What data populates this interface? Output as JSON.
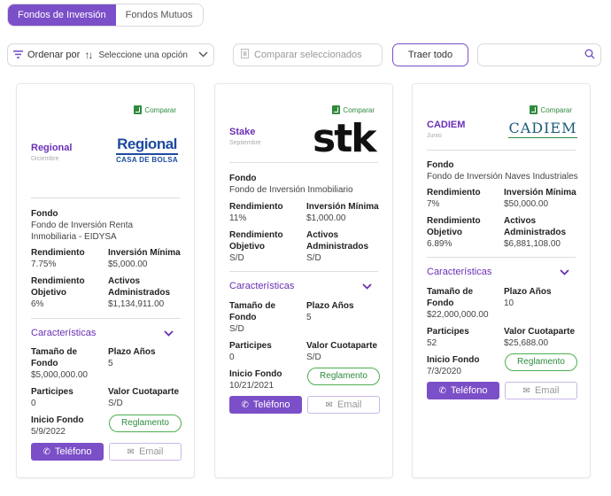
{
  "tabs": [
    {
      "label": "Fondos de Inversión",
      "active": true
    },
    {
      "label": "Fondos Mutuos",
      "active": false
    }
  ],
  "toolbar": {
    "sort_label": "Ordenar por",
    "select_placeholder": "Seleccione una opción",
    "compare_label": "Comparar seleccionados",
    "traer_label": "Traer todo",
    "search_value": ""
  },
  "colors": {
    "accent": "#7b4fc8",
    "compare_green": "#2e8b3e"
  },
  "cards": [
    {
      "name": "Regional",
      "subtitle": "Diciembre",
      "compare": "Comparar",
      "logo": {
        "line1": "Regional",
        "line2": "CASA DE BOLSA"
      },
      "fondo_label": "Fondo",
      "fondo_value": "Fondo de Inversión Renta Inmobiliaria - EIDYSA",
      "rendimiento_label": "Rendimiento",
      "rendimiento_value": "7.75%",
      "inversion_label": "Inversión Mínima",
      "inversion_value": "$5,000.00",
      "rend_obj_label": "Rendimiento Objetivo",
      "rend_obj_value": "6%",
      "activos_label": "Activos Administrados",
      "activos_value": "$1,134,911.00",
      "caracteristicas": "Características",
      "tamano_label": "Tamaño de Fondo",
      "tamano_value": "$5,000,000.00",
      "plazo_label": "Plazo Años",
      "plazo_value": "5",
      "participes_label": "Participes",
      "participes_value": "0",
      "cuotaparte_label": "Valor Cuotaparte",
      "cuotaparte_value": "S/D",
      "inicio_label": "Inicio Fondo",
      "inicio_value": "5/9/2022",
      "reglamento": "Reglamento",
      "telefono": "Teléfono",
      "email": "Email"
    },
    {
      "name": "Stake",
      "subtitle": "Septiembre",
      "compare": "Comparar",
      "logo": {
        "line1": "stk"
      },
      "fondo_label": "Fondo",
      "fondo_value": "Fondo de Inversión Inmobiliario",
      "rendimiento_label": "Rendimiento",
      "rendimiento_value": "11%",
      "inversion_label": "Inversión Mínima",
      "inversion_value": "$1,000.00",
      "rend_obj_label": "Rendimiento Objetivo",
      "rend_obj_value": "S/D",
      "activos_label": "Activos Administrados",
      "activos_value": "S/D",
      "caracteristicas": "Características",
      "tamano_label": "Tamaño de Fondo",
      "tamano_value": "S/D",
      "plazo_label": "Plazo Años",
      "plazo_value": "5",
      "participes_label": "Participes",
      "participes_value": "0",
      "cuotaparte_label": "Valor Cuotaparte",
      "cuotaparte_value": "S/D",
      "inicio_label": "Inicio Fondo",
      "inicio_value": "10/21/2021",
      "reglamento": "Reglamento",
      "telefono": "Teléfono",
      "email": "Email"
    },
    {
      "name": "CADIEM",
      "subtitle": "Junio",
      "compare": "Comparar",
      "logo": {
        "line1": "CADIEM"
      },
      "fondo_label": "Fondo",
      "fondo_value": "Fondo de Inversión Naves Industriales",
      "rendimiento_label": "Rendimiento",
      "rendimiento_value": "7%",
      "inversion_label": "Inversión Mínima",
      "inversion_value": "$50,000.00",
      "rend_obj_label": "Rendimiento Objetivo",
      "rend_obj_value": "6.89%",
      "activos_label": "Activos Administrados",
      "activos_value": "$6,881,108.00",
      "caracteristicas": "Características",
      "tamano_label": "Tamaño de Fondo",
      "tamano_value": "$22,000,000.00",
      "plazo_label": "Plazo Años",
      "plazo_value": "10",
      "participes_label": "Participes",
      "participes_value": "52",
      "cuotaparte_label": "Valor Cuotaparte",
      "cuotaparte_value": "$25,688.00",
      "inicio_label": "Inicio Fondo",
      "inicio_value": "7/3/2020",
      "reglamento": "Reglamento",
      "telefono": "Teléfono",
      "email": "Email"
    }
  ]
}
